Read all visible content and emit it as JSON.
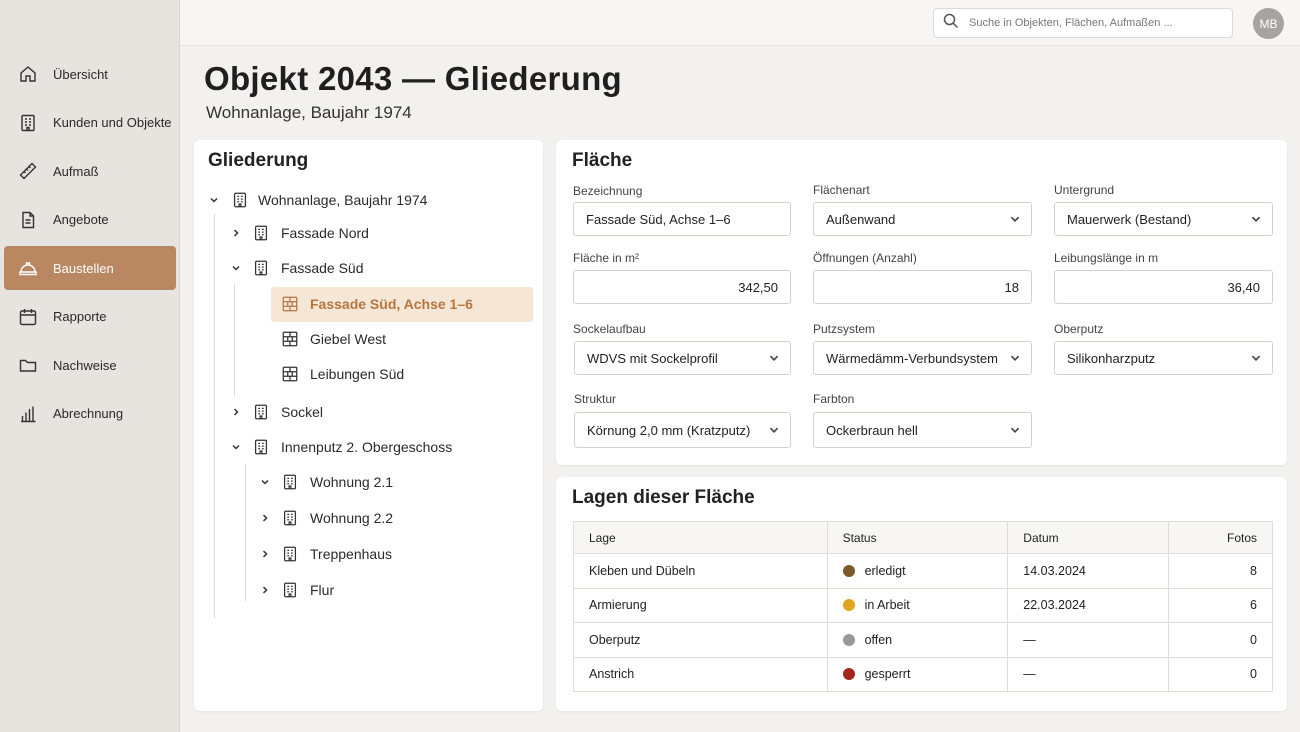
{
  "search": {
    "placeholder": "Suche in Objekten, Flächen, Aufmaßen ..."
  },
  "user": {
    "initials": "MB"
  },
  "nav": [
    {
      "label": "Übersicht",
      "icon": "home-icon"
    },
    {
      "label": "Kunden und Objekte",
      "icon": "building-icon"
    },
    {
      "label": "Aufmaß",
      "icon": "ruler-icon"
    },
    {
      "label": "Angebote",
      "icon": "document-icon"
    },
    {
      "label": "Baustellen",
      "icon": "hardhat-icon",
      "active": true
    },
    {
      "label": "Rapporte",
      "icon": "calendar-icon"
    },
    {
      "label": "Nachweise",
      "icon": "folder-icon"
    },
    {
      "label": "Abrechnung",
      "icon": "bar-chart-icon"
    }
  ],
  "page": {
    "title": "Objekt 2043 — Gliederung",
    "subtitle": "Wohnanlage, Baujahr 1974"
  },
  "tree": {
    "title": "Gliederung",
    "nodes": [
      {
        "label": "Wohnanlage, Baujahr 1974",
        "expanded": true
      },
      {
        "label": "Fassade Nord",
        "expanded": false
      },
      {
        "label": "Fassade Süd",
        "expanded": true
      },
      {
        "label": "Fassade Süd, Achse 1–6",
        "selected": true
      },
      {
        "label": "Giebel West"
      },
      {
        "label": "Leibungen Süd"
      },
      {
        "label": "Sockel",
        "expanded": false
      },
      {
        "label": "Innenputz 2. Obergeschoss",
        "expanded": true
      },
      {
        "label": "Wohnung 2.1",
        "expanded": true
      },
      {
        "label": "Wohnung 2.2",
        "expanded": false
      },
      {
        "label": "Treppenhaus",
        "expanded": false
      },
      {
        "label": "Flur",
        "expanded": false
      }
    ]
  },
  "form": {
    "title": "Fläche",
    "bezeichnung": {
      "label": "Bezeichnung",
      "value": "Fassade Süd, Achse 1–6"
    },
    "flaechenart": {
      "label": "Flächenart",
      "value": "Außenwand"
    },
    "untergrund": {
      "label": "Untergrund",
      "value": "Mauerwerk (Bestand)"
    },
    "flaeche": {
      "label": "Fläche in m²",
      "value": "342,50"
    },
    "oeffnungen": {
      "label": "Öffnungen (Anzahl)",
      "value": "18"
    },
    "leibung": {
      "label": "Leibungslänge in m",
      "value": "36,40"
    },
    "sockel": {
      "label": "Sockelaufbau",
      "value": "WDVS mit Sockelprofil"
    },
    "putzsystem": {
      "label": "Putzsystem",
      "value": "Wärmedämm-Verbundsystem"
    },
    "oberputz": {
      "label": "Oberputz",
      "value": "Silikonharzputz"
    },
    "struktur": {
      "label": "Struktur",
      "value": "Körnung 2,0 mm (Kratzputz)"
    },
    "farbton": {
      "label": "Farbton",
      "value": "Ockerbraun hell"
    }
  },
  "layers": {
    "title": "Lagen dieser Fläche",
    "headers": {
      "lage": "Lage",
      "status": "Status",
      "datum": "Datum",
      "fotos": "Fotos"
    },
    "rows": [
      {
        "lage": "Kleben und Dübeln",
        "status": "erledigt",
        "color": "#7d5a2c",
        "datum": "14.03.2024",
        "fotos": "8"
      },
      {
        "lage": "Armierung",
        "status": "in Arbeit",
        "color": "#e0a51c",
        "datum": "22.03.2024",
        "fotos": "6"
      },
      {
        "lage": "Oberputz",
        "status": "offen",
        "color": "#9a9896",
        "datum": "—",
        "fotos": "0"
      },
      {
        "lage": "Anstrich",
        "status": "gesperrt",
        "color": "#a4271d",
        "datum": "—",
        "fotos": "0"
      }
    ]
  }
}
